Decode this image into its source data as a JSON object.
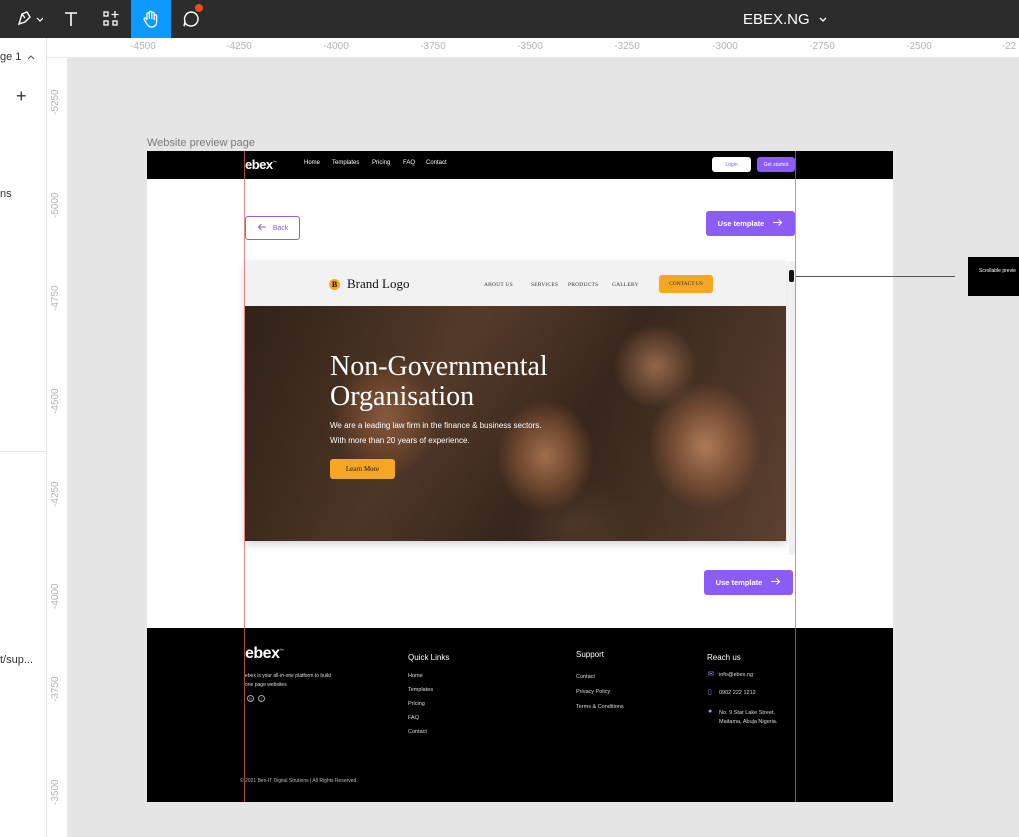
{
  "toolbar": {
    "document_title": "EBEX.NG",
    "tools": [
      "pen-tool",
      "text-tool",
      "components-tool",
      "hand-tool",
      "comment-tool"
    ],
    "active_tool": "hand-tool",
    "accent": "#0d99ff"
  },
  "left_panel": {
    "page_label": "ge 1",
    "fragment_1": "ns",
    "fragment_2": "t/sup..."
  },
  "rulers": {
    "top": [
      "-4500",
      "-4250",
      "-4000",
      "-3750",
      "-3500",
      "-3250",
      "-3000",
      "-2750",
      "-2500",
      "-22"
    ],
    "left": [
      "-5250",
      "-5000",
      "-4750",
      "-4500",
      "-4250",
      "-4000",
      "-3750",
      "-3500"
    ]
  },
  "canvas": {
    "frame_label": "Website preview page",
    "annotation_text": "Scrollable previe"
  },
  "site": {
    "brand": "ebex",
    "trademark": "™",
    "nav_links": [
      "Home",
      "Templates",
      "Pricing",
      "FAQ",
      "Contact"
    ],
    "login_label": "Login",
    "get_started_label": "Get started",
    "back_label": "Back",
    "use_template_label": "Use template",
    "accent": "#8b5cf6"
  },
  "preview": {
    "brand_mark": "B",
    "brand_name": "Brand Logo",
    "nav_links": [
      "ABOUT US",
      "SERVICES",
      "PRODUCTS",
      "GALLERY"
    ],
    "contact_label": "CONTACT US",
    "hero_title_line1": "Non-Governmental",
    "hero_title_line2": "Organisation",
    "hero_subtitle": "We are a leading law firm in the finance & business sectors. With more than 20 years of experience.",
    "cta_label": "Learn More",
    "cta_color": "#f5a623"
  },
  "footer": {
    "tagline": "ebex is your all-in-one platform to build one page websites",
    "social": [
      "instagram-icon",
      "facebook-icon"
    ],
    "quick_links": {
      "heading": "Quick Links",
      "items": [
        "Home",
        "Templates",
        "Pricing",
        "FAQ",
        "Contact"
      ]
    },
    "support": {
      "heading": "Support",
      "items": [
        "Contact",
        "Privacy Policy",
        "Terms & Conditions"
      ]
    },
    "reach": {
      "heading": "Reach us",
      "email": "info@ebex.ng",
      "phone": "0902 222 1212",
      "address": "No. 9 Star Lake Street, Maitama, Abuja Nigeria."
    },
    "copyright": "© 2021 Bex-IT Digital Strutions | All Rights Reserved."
  }
}
